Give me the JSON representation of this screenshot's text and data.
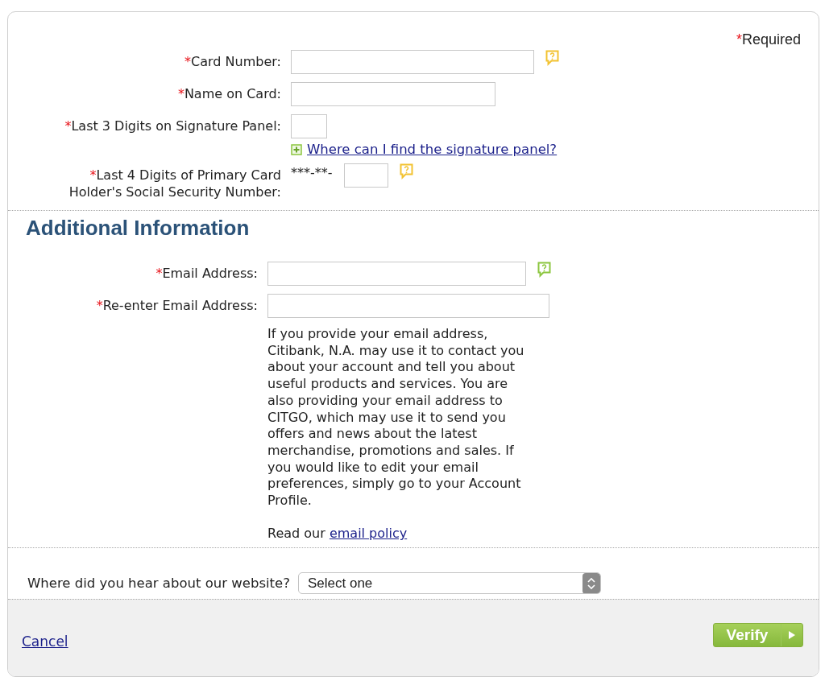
{
  "required_note": {
    "marker": "*",
    "text": "Required"
  },
  "card_fields": [
    {
      "kind": "text",
      "marker": "*",
      "label": "Card Number:",
      "help": {
        "color": "#f2c230"
      }
    },
    {
      "kind": "text",
      "marker": "*",
      "label": "Name on Card:"
    },
    {
      "kind": "text",
      "marker": "*",
      "label": "Last 3 Digits on Signature Panel:",
      "link": {
        "text": "Where can I find the signature panel?"
      }
    },
    {
      "kind": "prefixed",
      "marker": "*",
      "label": "Last 4 Digits of Primary Card Holder's Social Security Number:",
      "prefix": "***-**-",
      "help": {
        "color": "#f2c230"
      }
    }
  ],
  "additional": {
    "heading": "Additional Information",
    "fields": [
      {
        "kind": "text",
        "marker": "*",
        "label": "Email Address:",
        "help": {
          "color": "#8cc63f"
        }
      },
      {
        "kind": "text",
        "marker": "*",
        "label": "Re-enter Email Address:"
      }
    ],
    "notice": "If you provide your email address, Citibank, N.A. may use it to contact you about your account and tell you about useful products and services. You are also providing your email address to CITGO, which may use it to send you offers and news about the latest merchandise, promotions and sales. If you would like to edit your email preferences, simply go to your Account Profile.",
    "policy": {
      "before": "Read our ",
      "link": "email policy"
    }
  },
  "survey": {
    "label": "Where did you hear about our website?",
    "select": "Select one"
  },
  "footer": {
    "cancel": "Cancel",
    "verify": "Verify"
  }
}
